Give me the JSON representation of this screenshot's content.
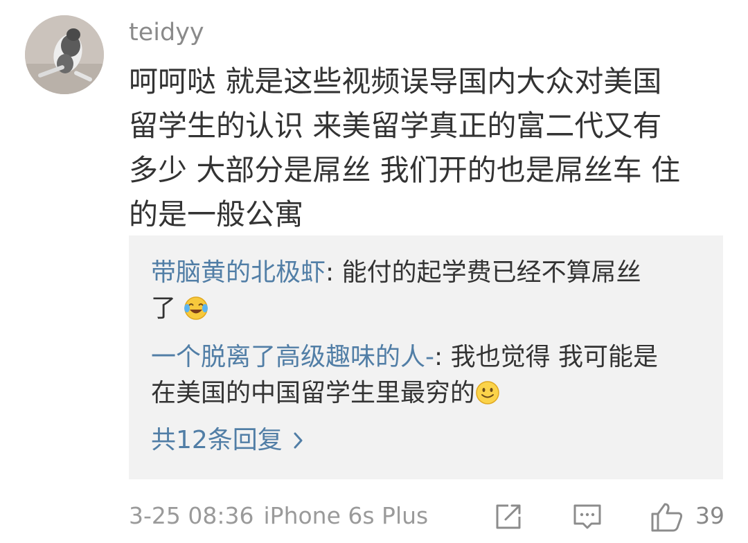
{
  "comment": {
    "username": "teidyy",
    "lines": [
      "呵呵哒 就是这些视频误导国内大众对美国",
      "留学生的认识 来美留学真正的富二代又有",
      "多少 大部分是屌丝 我们开的也是屌丝车 住",
      "的是一般公寓"
    ]
  },
  "replies": [
    {
      "author": "带脑黄的北极虾",
      "sep": ": ",
      "text_line1": "能付的起学费已经不算屌丝",
      "text_line2": "了",
      "emoji": "laugh-cry-emoji"
    },
    {
      "author": "一个脱离了高级趣味的人-",
      "sep": ": ",
      "text_line1": "我也觉得 我可能是",
      "text_line2": "在美国的中国留学生里最穷的",
      "emoji": "smile-emoji"
    }
  ],
  "more_replies_label": "共12条回复",
  "footer": {
    "timestamp": "3-25 08:36",
    "device": "iPhone 6s Plus",
    "like_count": "39"
  },
  "colors": {
    "link": "#517ea6",
    "meta": "#9a9a9a",
    "reply_bg": "#f2f2f2"
  }
}
